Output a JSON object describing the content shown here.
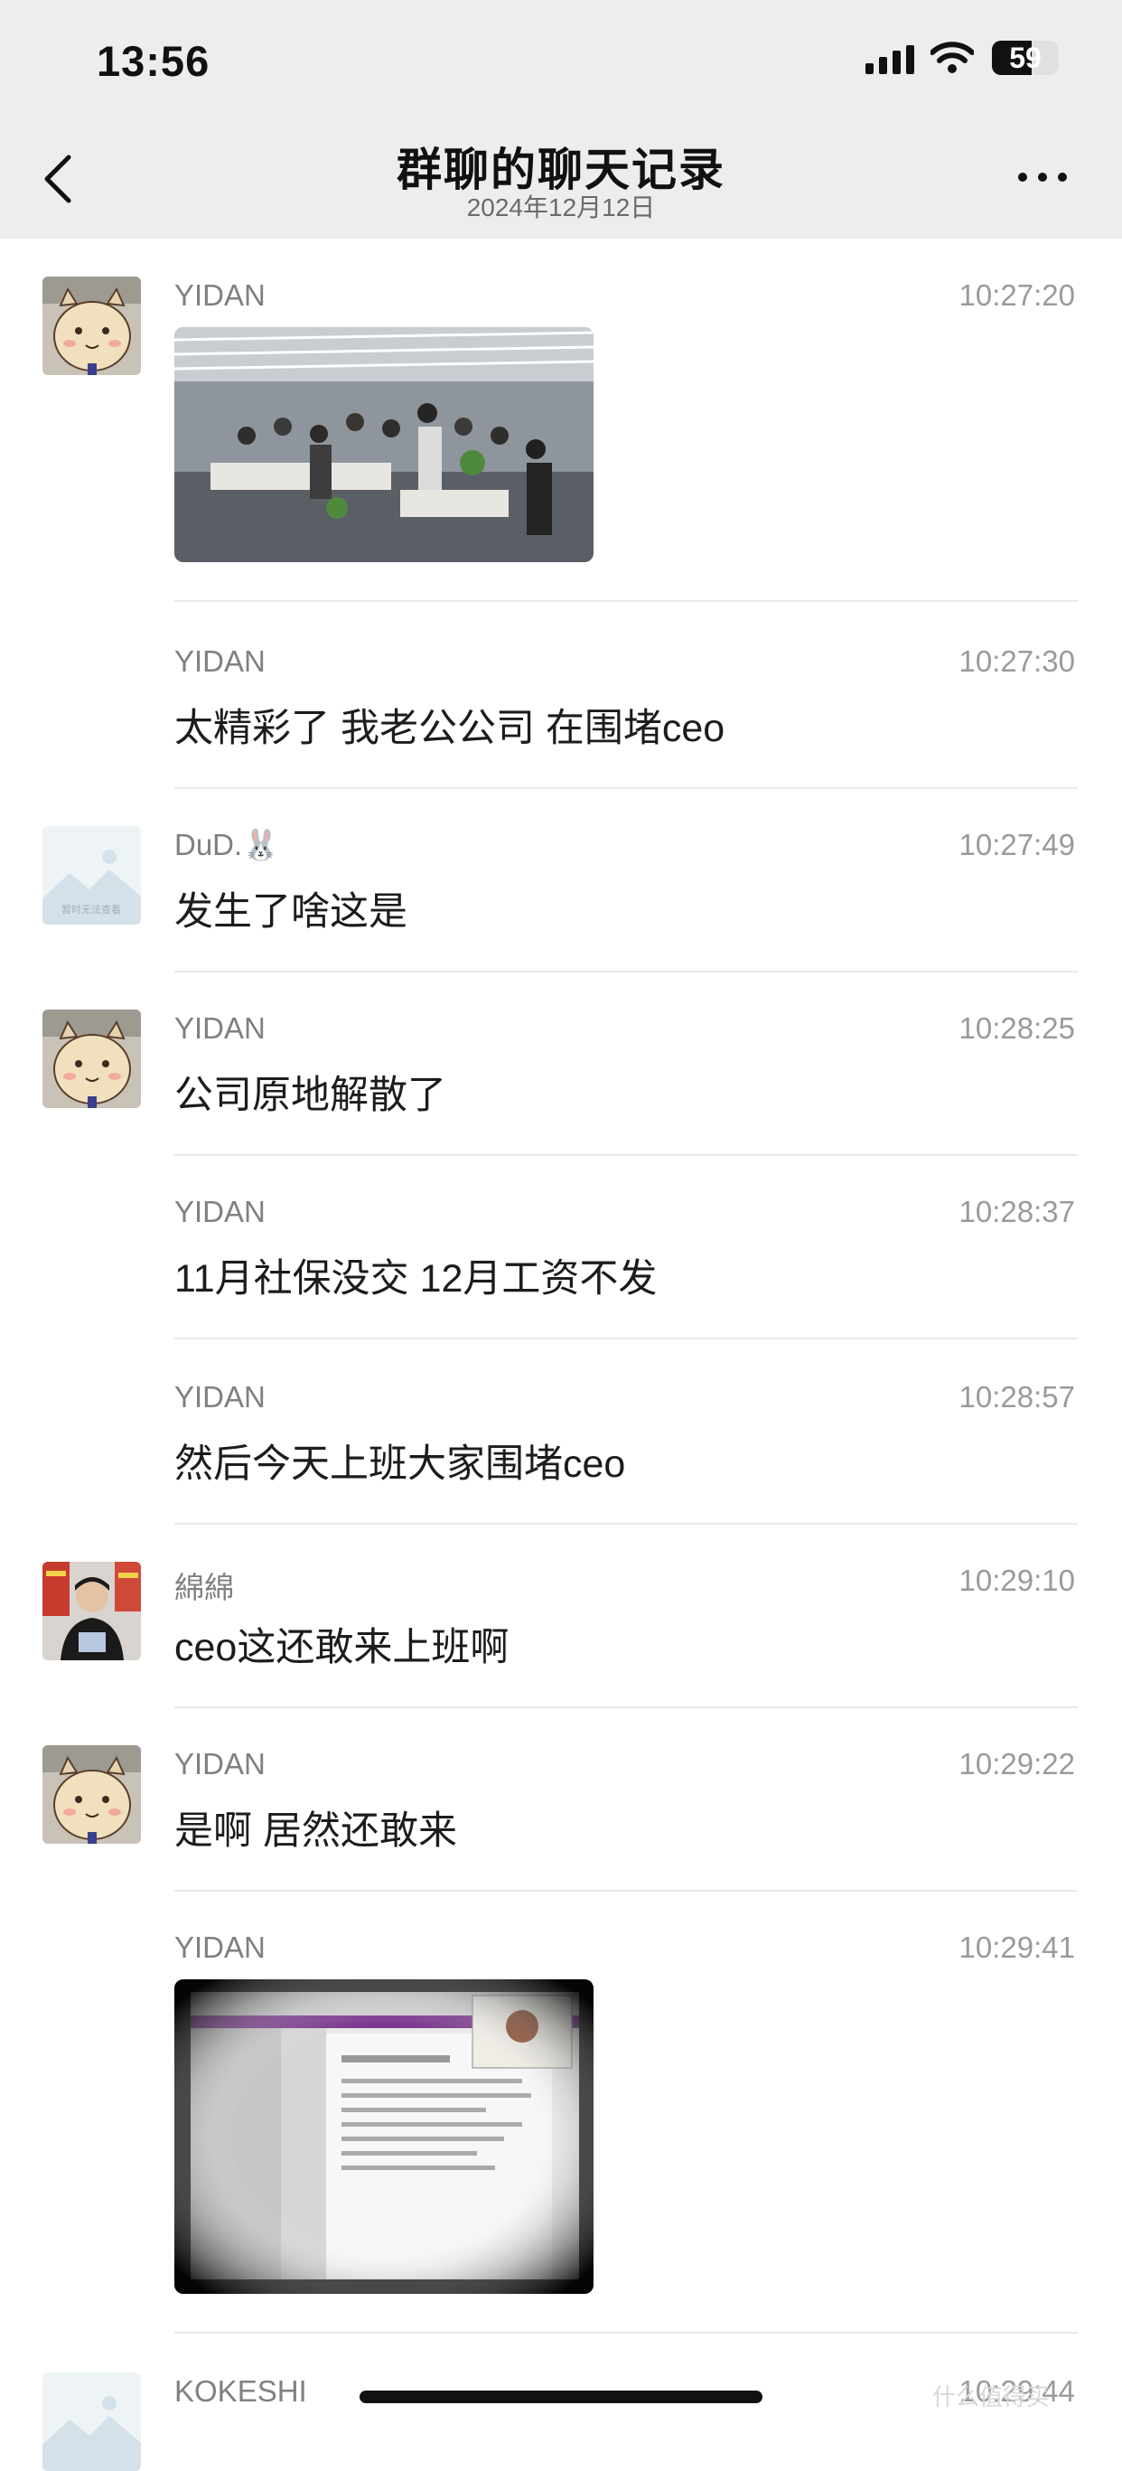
{
  "status_bar": {
    "time": "13:56",
    "battery": "59",
    "battery_level": 0.59
  },
  "nav": {
    "title": "群聊的聊天记录",
    "subtitle": "2024年12月12日",
    "back_icon": "chevron-left-icon",
    "more_icon": "more-dots-icon"
  },
  "messages": [
    {
      "sender": "YIDAN",
      "time": "10:27:20",
      "type": "image",
      "avatar": "cartoon-avatar"
    },
    {
      "sender": "YIDAN",
      "time": "10:27:30",
      "type": "text",
      "text": "太精彩了 我老公公司 在围堵ceo"
    },
    {
      "sender": "DuD.🐰",
      "time": "10:27:49",
      "type": "text",
      "text": "发生了啥这是",
      "avatar": "unavailable-avatar",
      "avatar_caption": "暂时无法查看"
    },
    {
      "sender": "YIDAN",
      "time": "10:28:25",
      "type": "text",
      "text": "公司原地解散了",
      "avatar": "cartoon-avatar"
    },
    {
      "sender": "YIDAN",
      "time": "10:28:37",
      "type": "text",
      "text": "11月社保没交 12月工资不发"
    },
    {
      "sender": "YIDAN",
      "time": "10:28:57",
      "type": "text",
      "text": "然后今天上班大家围堵ceo"
    },
    {
      "sender": "綿綿",
      "time": "10:29:10",
      "type": "text",
      "text": "ceo这还敢来上班啊",
      "avatar": "photo-avatar"
    },
    {
      "sender": "YIDAN",
      "time": "10:29:22",
      "type": "text",
      "text": "是啊 居然还敢来",
      "avatar": "cartoon-avatar"
    },
    {
      "sender": "YIDAN",
      "time": "10:29:41",
      "type": "image"
    },
    {
      "sender": "KOKESHI",
      "time": "10:29:44",
      "type": "text",
      "avatar": "unavailable-avatar"
    }
  ],
  "watermark": "什么值得买"
}
